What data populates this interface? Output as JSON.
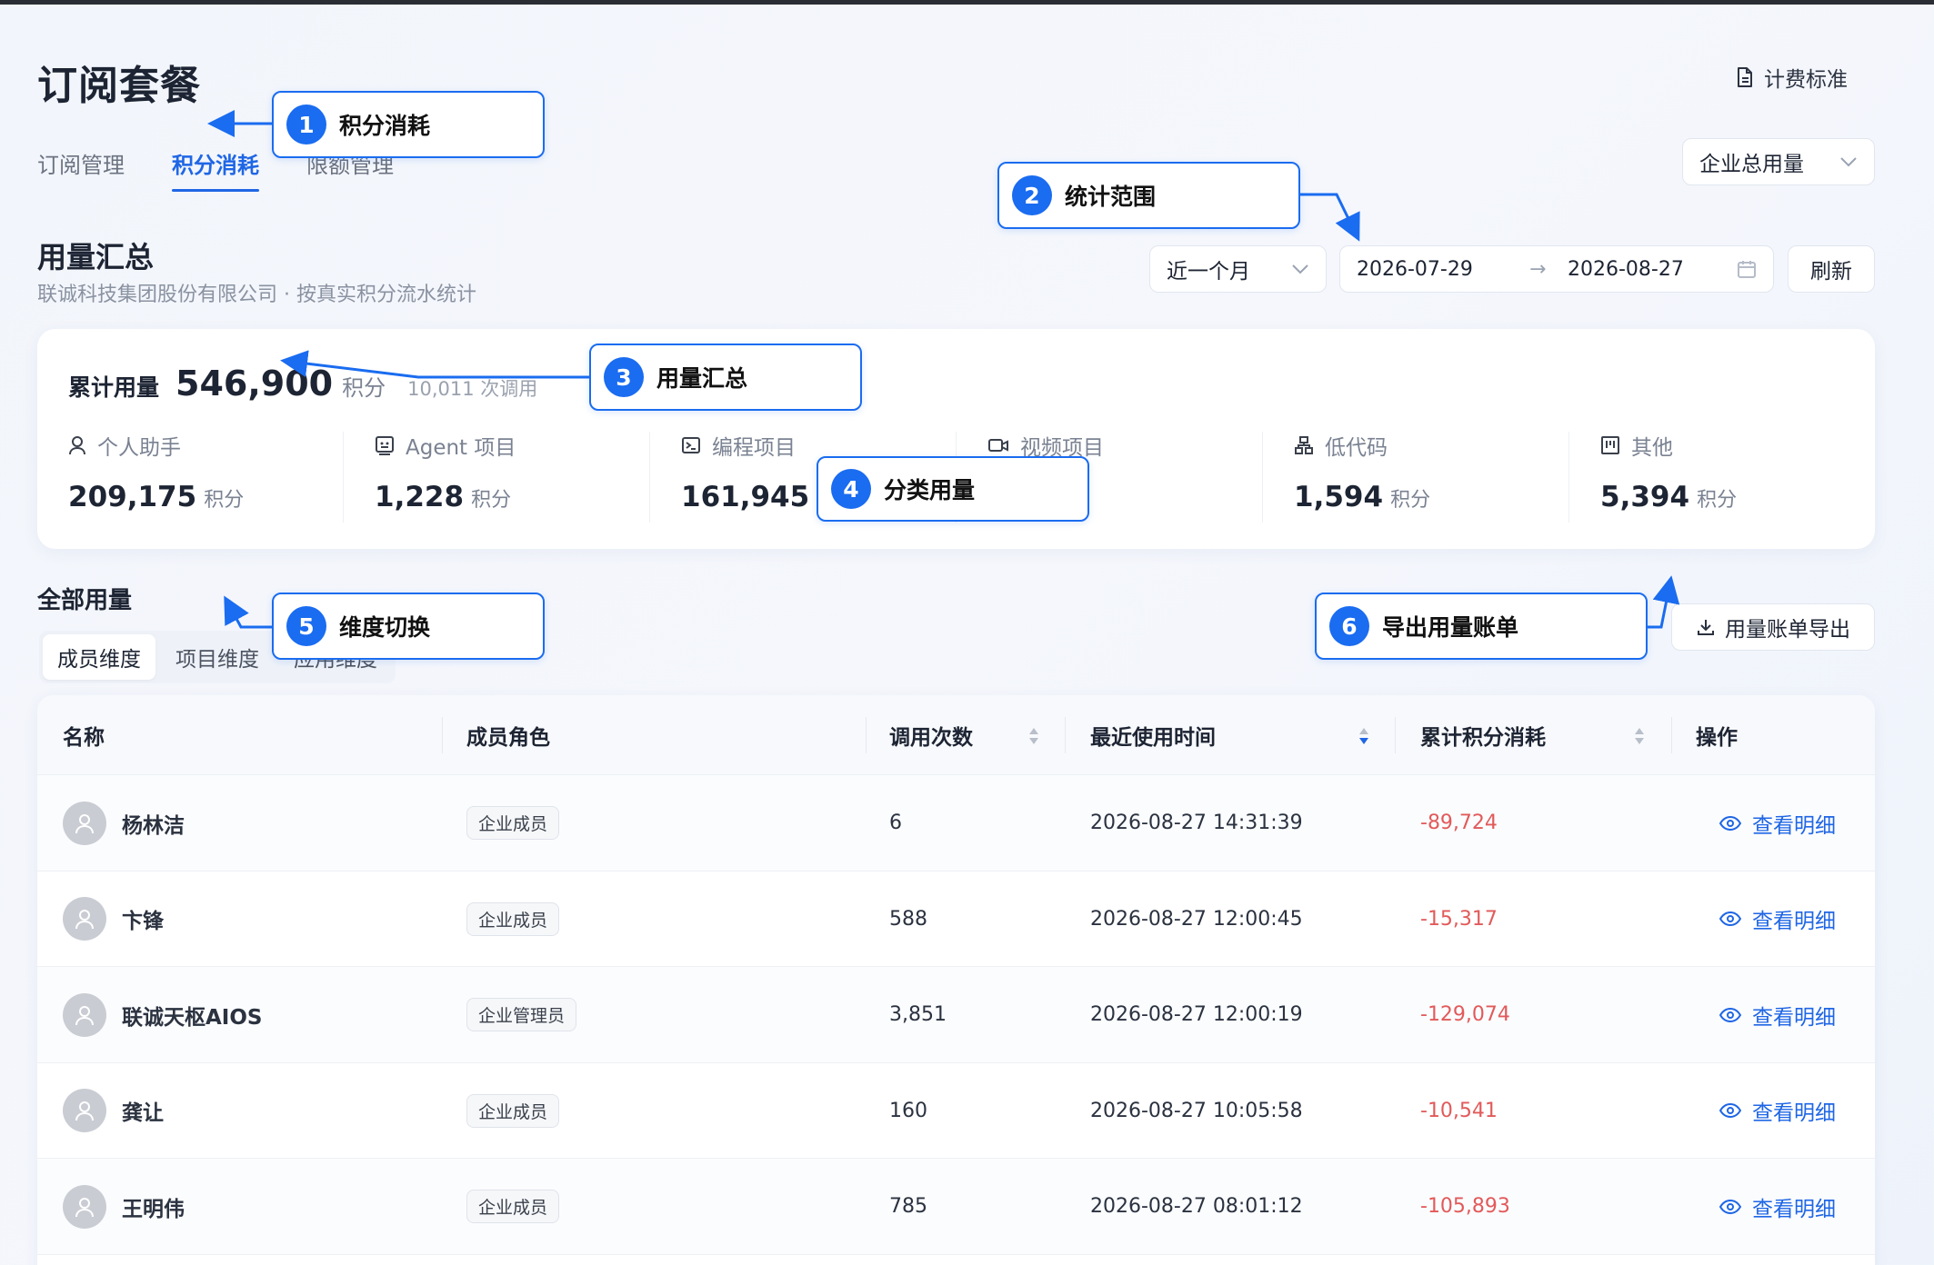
{
  "header": {
    "title": "订阅套餐",
    "billing_link": "计费标准",
    "tabs": [
      "订阅管理",
      "积分消耗",
      "限额管理"
    ],
    "scope_select": "企业总用量"
  },
  "summary": {
    "title": "用量汇总",
    "subtitle": "联诚科技集团股份有限公司 · 按真实积分流水统计",
    "range_select": "近一个月",
    "date_start": "2026-07-29",
    "date_arrow": "→",
    "date_end": "2026-08-27",
    "refresh_label": "刷新",
    "total_label": "累计用量",
    "total_value": "546,900",
    "total_unit": "积分",
    "total_calls": "10,011 次调用",
    "categories": [
      {
        "icon": "user-icon",
        "label": "个人助手",
        "value": "209,175",
        "unit": "积分"
      },
      {
        "icon": "agent-icon",
        "label": "Agent 项目",
        "value": "1,228",
        "unit": "积分"
      },
      {
        "icon": "terminal-icon",
        "label": "编程项目",
        "value": "161,945",
        "unit": "积分"
      },
      {
        "icon": "video-icon",
        "label": "视频项目",
        "value": "",
        "unit": "积分"
      },
      {
        "icon": "lowcode-icon",
        "label": "低代码",
        "value": "1,594",
        "unit": "积分"
      },
      {
        "icon": "other-icon",
        "label": "其他",
        "value": "5,394",
        "unit": "积分"
      }
    ]
  },
  "all_usage": {
    "title": "全部用量",
    "dimension_tabs": [
      "成员维度",
      "项目维度",
      "应用维度"
    ],
    "export_label": "用量账单导出"
  },
  "table": {
    "columns": [
      "名称",
      "成员角色",
      "调用次数",
      "最近使用时间",
      "累计积分消耗",
      "操作"
    ],
    "action_label": "查看明细",
    "rows": [
      {
        "name": "杨林洁",
        "role": "企业成员",
        "calls": "6",
        "last_used": "2026-08-27 14:31:39",
        "credits": "-89,724"
      },
      {
        "name": "卞锋",
        "role": "企业成员",
        "calls": "588",
        "last_used": "2026-08-27 12:00:45",
        "credits": "-15,317"
      },
      {
        "name": "联诚天枢AIOS",
        "role": "企业管理员",
        "calls": "3,851",
        "last_used": "2026-08-27 12:00:19",
        "credits": "-129,074"
      },
      {
        "name": "龚让",
        "role": "企业成员",
        "calls": "160",
        "last_used": "2026-08-27 10:05:58",
        "credits": "-10,541"
      },
      {
        "name": "王明伟",
        "role": "企业成员",
        "calls": "785",
        "last_used": "2026-08-27 08:01:12",
        "credits": "-105,893"
      }
    ]
  },
  "annotations": [
    {
      "num": "1",
      "label": "积分消耗"
    },
    {
      "num": "2",
      "label": "统计范围"
    },
    {
      "num": "3",
      "label": "用量汇总"
    },
    {
      "num": "4",
      "label": "分类用量"
    },
    {
      "num": "5",
      "label": "维度切换"
    },
    {
      "num": "6",
      "label": "导出用量账单"
    }
  ],
  "colors": {
    "accent": "#1f66e5",
    "annotation": "#1a6cf0",
    "negative": "#e25a5a"
  }
}
